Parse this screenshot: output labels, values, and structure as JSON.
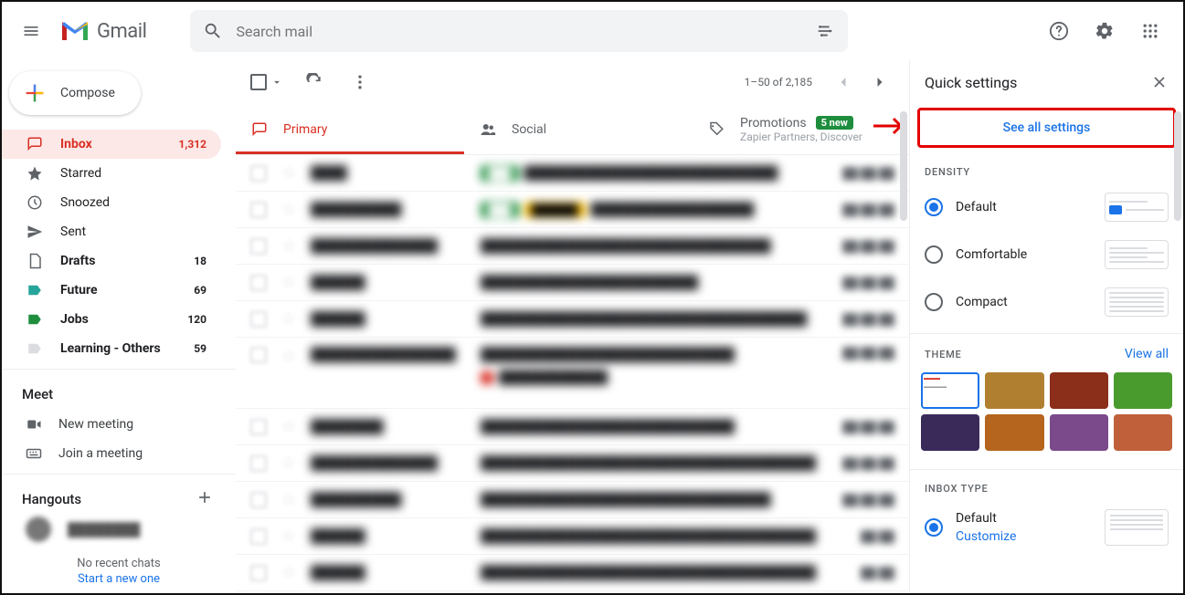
{
  "header": {
    "product": "Gmail",
    "search_placeholder": "Search mail"
  },
  "compose_label": "Compose",
  "nav": [
    {
      "icon": "inbox",
      "label": "Inbox",
      "count": "1,312",
      "active": true,
      "bold": true
    },
    {
      "icon": "star",
      "label": "Starred",
      "count": "",
      "active": false,
      "bold": false
    },
    {
      "icon": "clock",
      "label": "Snoozed",
      "count": "",
      "active": false,
      "bold": false
    },
    {
      "icon": "send",
      "label": "Sent",
      "count": "",
      "active": false,
      "bold": false
    },
    {
      "icon": "file",
      "label": "Drafts",
      "count": "18",
      "active": false,
      "bold": true
    },
    {
      "icon": "label-teal",
      "label": "Future",
      "count": "69",
      "active": false,
      "bold": true
    },
    {
      "icon": "label-green",
      "label": "Jobs",
      "count": "120",
      "active": false,
      "bold": true
    },
    {
      "icon": "label-grey",
      "label": "Learning - Others",
      "count": "59",
      "active": false,
      "bold": true
    }
  ],
  "meet": {
    "title": "Meet",
    "items": [
      {
        "icon": "video",
        "label": "New meeting"
      },
      {
        "icon": "keyboard",
        "label": "Join a meeting"
      }
    ]
  },
  "hangouts": {
    "title": "Hangouts",
    "no_chats": "No recent chats",
    "start_new": "Start a new one"
  },
  "toolbar": {
    "pager": "1–50 of 2,185"
  },
  "tabs": [
    {
      "icon": "inbox",
      "label": "Primary",
      "active": true
    },
    {
      "icon": "people",
      "label": "Social",
      "active": false
    },
    {
      "icon": "tag",
      "label": "Promotions",
      "badge": "5 new",
      "sub": "Zapier Partners, Discover",
      "active": false
    }
  ],
  "mails": [
    {
      "sender": "████",
      "subject": "████████████████████████████",
      "time": "██:██ ██",
      "chip": "#1e8e3e",
      "lines": 1
    },
    {
      "sender": "██████████",
      "subject": "██████████████████",
      "time": "██:██ ██",
      "chip": "#1e8e3e",
      "chip2": "#fbbc04",
      "lines": 1
    },
    {
      "sender": "██████████████",
      "subject": "████████████████████████████████",
      "time": "██:██ ██",
      "lines": 1
    },
    {
      "sender": "██████",
      "subject": "████████████████████████",
      "time": "██:██ ██",
      "lines": 1
    },
    {
      "sender": "██████",
      "subject": "████████████████████████████████████",
      "time": "██:██ ██",
      "lines": 1
    },
    {
      "sender": "████████████████",
      "subject": "████████████████████████████",
      "time": "██:██ ██",
      "lines": 2
    },
    {
      "sender": "████████",
      "subject": "████████████████████████████",
      "time": "██:██ ██",
      "lines": 1
    },
    {
      "sender": "██████████████",
      "subject": "████████████████████████████████████████",
      "time": "██:██ ██",
      "lines": 1
    },
    {
      "sender": "██████████",
      "subject": "████████████████████████████████",
      "time": "██:██ ██",
      "lines": 1
    },
    {
      "sender": "██████",
      "subject": "████████████████████████████████████████████",
      "time": "██ ██",
      "lines": 1
    },
    {
      "sender": "██████",
      "subject": "████████████████████████████████████████████",
      "time": "██ ██",
      "lines": 1
    }
  ],
  "quick": {
    "title": "Quick settings",
    "see_all": "See all settings",
    "density_title": "Density",
    "density": [
      {
        "label": "Default",
        "selected": true
      },
      {
        "label": "Comfortable",
        "selected": false
      },
      {
        "label": "Compact",
        "selected": false
      }
    ],
    "theme_title": "Theme",
    "view_all": "View all",
    "theme_colors": [
      "#ffffff",
      "#b08030",
      "#8b2e1a",
      "#4a9b2e",
      "#3a2a5a",
      "#b5651d",
      "#7a4a8a",
      "#c0603a"
    ],
    "inbox_title": "Inbox type",
    "inbox": {
      "label": "Default",
      "customize": "Customize",
      "selected": true
    }
  }
}
